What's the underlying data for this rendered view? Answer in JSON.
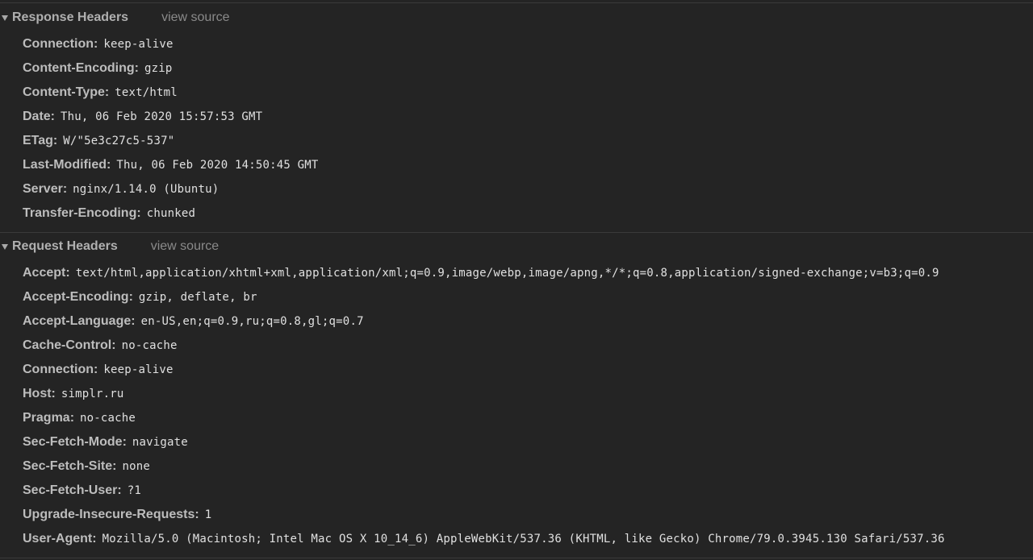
{
  "response": {
    "title": "Response Headers",
    "view_source": "view source",
    "headers": [
      {
        "name": "Connection:",
        "value": "keep-alive"
      },
      {
        "name": "Content-Encoding:",
        "value": "gzip"
      },
      {
        "name": "Content-Type:",
        "value": "text/html"
      },
      {
        "name": "Date:",
        "value": "Thu, 06 Feb 2020 15:57:53 GMT"
      },
      {
        "name": "ETag:",
        "value": "W/\"5e3c27c5-537\""
      },
      {
        "name": "Last-Modified:",
        "value": "Thu, 06 Feb 2020 14:50:45 GMT"
      },
      {
        "name": "Server:",
        "value": "nginx/1.14.0 (Ubuntu)"
      },
      {
        "name": "Transfer-Encoding:",
        "value": "chunked"
      }
    ]
  },
  "request": {
    "title": "Request Headers",
    "view_source": "view source",
    "headers": [
      {
        "name": "Accept:",
        "value": "text/html,application/xhtml+xml,application/xml;q=0.9,image/webp,image/apng,*/*;q=0.8,application/signed-exchange;v=b3;q=0.9"
      },
      {
        "name": "Accept-Encoding:",
        "value": "gzip, deflate, br"
      },
      {
        "name": "Accept-Language:",
        "value": "en-US,en;q=0.9,ru;q=0.8,gl;q=0.7"
      },
      {
        "name": "Cache-Control:",
        "value": "no-cache"
      },
      {
        "name": "Connection:",
        "value": "keep-alive"
      },
      {
        "name": "Host:",
        "value": "simplr.ru"
      },
      {
        "name": "Pragma:",
        "value": "no-cache"
      },
      {
        "name": "Sec-Fetch-Mode:",
        "value": "navigate"
      },
      {
        "name": "Sec-Fetch-Site:",
        "value": "none"
      },
      {
        "name": "Sec-Fetch-User:",
        "value": "?1"
      },
      {
        "name": "Upgrade-Insecure-Requests:",
        "value": "1"
      },
      {
        "name": "User-Agent:",
        "value": "Mozilla/5.0 (Macintosh; Intel Mac OS X 10_14_6) AppleWebKit/537.36 (KHTML, like Gecko) Chrome/79.0.3945.130 Safari/537.36"
      }
    ]
  }
}
